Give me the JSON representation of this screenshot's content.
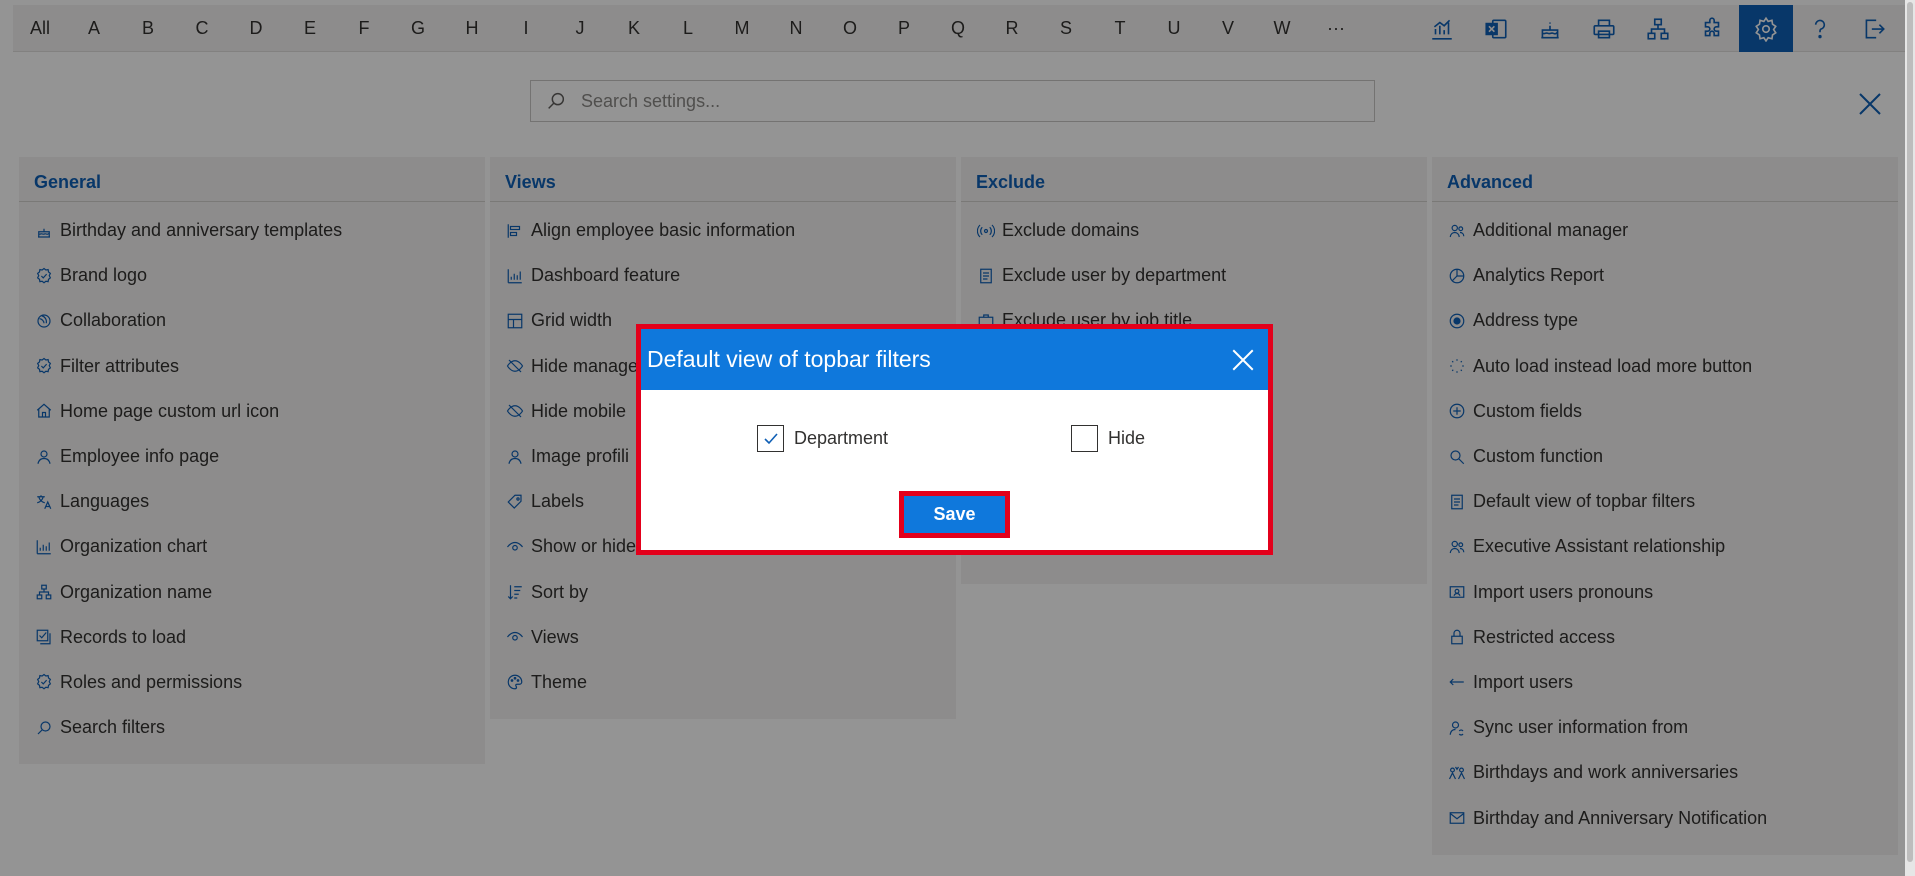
{
  "topbar": {
    "letters": [
      "All",
      "A",
      "B",
      "C",
      "D",
      "E",
      "F",
      "G",
      "H",
      "I",
      "J",
      "K",
      "L",
      "M",
      "N",
      "O",
      "P",
      "Q",
      "R",
      "S",
      "T",
      "U",
      "V",
      "W",
      "···"
    ],
    "icons": [
      "analytics-icon",
      "excel-export-icon",
      "birthday-cake-icon",
      "print-icon",
      "org-chart-icon",
      "puzzle-icon",
      "settings-icon",
      "help-icon",
      "sign-out-icon"
    ]
  },
  "search": {
    "placeholder": "Search settings..."
  },
  "columns": [
    {
      "title": "General",
      "items": [
        {
          "label": "Birthday and anniversary templates",
          "icon": "cake-icon"
        },
        {
          "label": "Brand logo",
          "icon": "badge-check-icon"
        },
        {
          "label": "Collaboration",
          "icon": "collaboration-icon"
        },
        {
          "label": "Filter attributes",
          "icon": "badge-check-icon"
        },
        {
          "label": "Home page custom url icon",
          "icon": "home-icon"
        },
        {
          "label": "Employee info page",
          "icon": "person-icon"
        },
        {
          "label": "Languages",
          "icon": "translate-icon"
        },
        {
          "label": "Organization chart",
          "icon": "chart-icon"
        },
        {
          "label": "Organization name",
          "icon": "org-icon"
        },
        {
          "label": "Records to load",
          "icon": "checklist-icon"
        },
        {
          "label": "Roles and permissions",
          "icon": "badge-check-icon"
        },
        {
          "label": "Search filters",
          "icon": "search-icon"
        }
      ]
    },
    {
      "title": "Views",
      "items": [
        {
          "label": "Align employee basic information",
          "icon": "align-icon"
        },
        {
          "label": "Dashboard feature",
          "icon": "chart-icon"
        },
        {
          "label": "Grid width",
          "icon": "grid-icon"
        },
        {
          "label": "Hide manage",
          "icon": "hide-icon"
        },
        {
          "label": "Hide mobile",
          "icon": "hide-icon"
        },
        {
          "label": "Image profili",
          "icon": "person-icon"
        },
        {
          "label": "Labels",
          "icon": "tag-icon"
        },
        {
          "label": "Show or hide",
          "icon": "eye-icon"
        },
        {
          "label": "Sort by",
          "icon": "sort-icon"
        },
        {
          "label": "Views",
          "icon": "eye-icon"
        },
        {
          "label": "Theme",
          "icon": "palette-icon"
        }
      ]
    },
    {
      "title": "Exclude",
      "items": [
        {
          "label": "Exclude domains",
          "icon": "broadcast-icon"
        },
        {
          "label": "Exclude user by department",
          "icon": "document-icon"
        },
        {
          "label": "Exclude user by job title",
          "icon": "briefcase-icon"
        },
        {
          "label": "",
          "icon": ""
        },
        {
          "label": "",
          "icon": ""
        },
        {
          "label": "",
          "icon": ""
        },
        {
          "label": "",
          "icon": ""
        },
        {
          "label": "",
          "icon": ""
        }
      ]
    },
    {
      "title": "Advanced",
      "items": [
        {
          "label": "Additional manager",
          "icon": "people-icon"
        },
        {
          "label": "Analytics Report",
          "icon": "analytics-icon"
        },
        {
          "label": "Address type",
          "icon": "radio-icon"
        },
        {
          "label": "Auto load instead load more button",
          "icon": "loading-icon"
        },
        {
          "label": "Custom fields",
          "icon": "add-circle-icon"
        },
        {
          "label": "Custom function",
          "icon": "search-code-icon"
        },
        {
          "label": "Default view of topbar filters",
          "icon": "document-icon"
        },
        {
          "label": "Executive Assistant relationship",
          "icon": "people-icon"
        },
        {
          "label": "Import users pronouns",
          "icon": "contact-card-icon"
        },
        {
          "label": "Restricted access",
          "icon": "lock-icon"
        },
        {
          "label": "Import users",
          "icon": "arrow-left-icon"
        },
        {
          "label": "Sync user information from",
          "icon": "person-sync-icon"
        },
        {
          "label": "Birthdays and work anniversaries",
          "icon": "celebrate-icon"
        },
        {
          "label": "Birthday and Anniversary Notification",
          "icon": "mail-icon"
        }
      ]
    }
  ],
  "modal": {
    "title": "Default view of topbar filters",
    "options": [
      {
        "label": "Department",
        "checked": true
      },
      {
        "label": "Hide",
        "checked": false
      }
    ],
    "save_label": "Save"
  },
  "colors": {
    "accent": "#0f78dc",
    "link": "#0f5fb5",
    "highlight": "#e3001b"
  }
}
